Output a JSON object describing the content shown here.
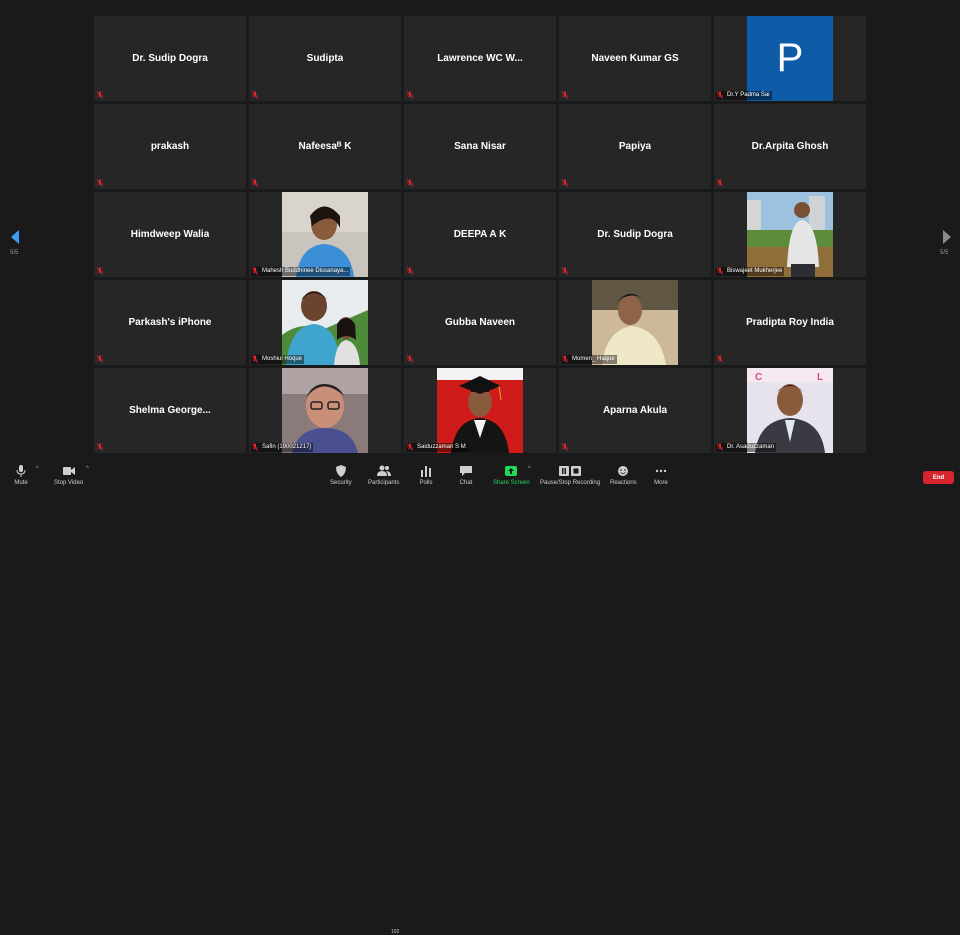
{
  "tiles": [
    {
      "kind": "name",
      "name": "Dr. Sudip Dogra"
    },
    {
      "kind": "name",
      "name": "Sudipta"
    },
    {
      "kind": "name",
      "name": "Lawrence WC W..."
    },
    {
      "kind": "name",
      "name": "Naveen Kumar GS"
    },
    {
      "kind": "avatar",
      "letter": "P",
      "caption": "Dr.Y Padma Sai",
      "color": "#0e5ba8"
    },
    {
      "kind": "name",
      "name": "prakash"
    },
    {
      "kind": "name",
      "name": "Nafeesaᴮ K"
    },
    {
      "kind": "name",
      "name": "Sana Nisar"
    },
    {
      "kind": "name",
      "name": "Papiya"
    },
    {
      "kind": "name",
      "name": "Dr.Arpita Ghosh"
    },
    {
      "kind": "name",
      "name": "Himdweep Walia"
    },
    {
      "kind": "photo",
      "caption": "Mahesh Buddhinee Dissanaya...",
      "photo": "woman-blue"
    },
    {
      "kind": "name",
      "name": "DEEPA A K"
    },
    {
      "kind": "name",
      "name": "Dr. Sudip Dogra"
    },
    {
      "kind": "photo",
      "caption": "Biswajeet Mukherjee",
      "photo": "man-outdoor"
    },
    {
      "kind": "name",
      "name": "Parkash's iPhone"
    },
    {
      "kind": "photo",
      "caption": "Moshiul Hoque",
      "photo": "selfie-pair"
    },
    {
      "kind": "name",
      "name": "Gubba Naveen"
    },
    {
      "kind": "photo",
      "caption": "Momen_ Haque",
      "photo": "young-man"
    },
    {
      "kind": "name",
      "name": "Pradipta Roy India"
    },
    {
      "kind": "name",
      "name": "Shelma  George..."
    },
    {
      "kind": "photo",
      "caption": "Safin (190021217)",
      "photo": "boy-glasses"
    },
    {
      "kind": "photo",
      "caption": "Saiduzzaman S M",
      "photo": "graduate-red"
    },
    {
      "kind": "name",
      "name": "Aparna Akula"
    },
    {
      "kind": "photo",
      "caption": "Dr. Asaduzzaman",
      "photo": "man-suit"
    }
  ],
  "pager": {
    "left": "5/5",
    "right": "5/5"
  },
  "toolbar": {
    "mute": "Mute",
    "stop_video": "Stop Video",
    "security": "Security",
    "participants": "Participants",
    "participants_count": "102",
    "polls": "Polls",
    "chat": "Chat",
    "share_screen": "Share Screen",
    "record": "Pause/Stop Recording",
    "reactions": "Reactions",
    "more": "More",
    "end": "End"
  },
  "colors": {
    "share": "#23d959",
    "end": "#d8242f",
    "mute_red": "#e02828"
  }
}
